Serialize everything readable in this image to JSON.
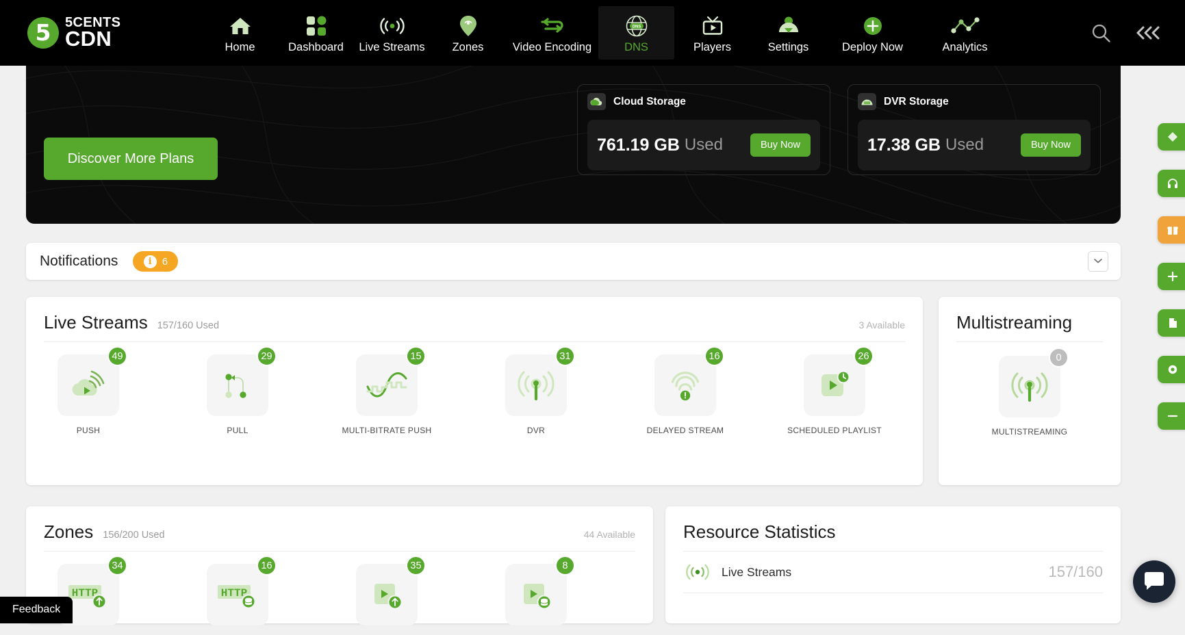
{
  "brand": {
    "mark": "5",
    "line1": "5CENTS",
    "line2": "CDN"
  },
  "nav": {
    "items": [
      {
        "label": "Home",
        "icon": "home-icon",
        "active": false
      },
      {
        "label": "Dashboard",
        "icon": "grid-icon",
        "active": false
      },
      {
        "label": "Live Streams",
        "icon": "broadcast-icon",
        "active": false
      },
      {
        "label": "Zones",
        "icon": "location-pin-icon",
        "active": false
      },
      {
        "label": "Video Encoding",
        "icon": "transcode-icon",
        "active": false
      },
      {
        "label": "DNS",
        "icon": "globe-dns-icon",
        "active": true
      },
      {
        "label": "Players",
        "icon": "tv-player-icon",
        "active": false
      },
      {
        "label": "Settings",
        "icon": "user-settings-icon",
        "active": false
      },
      {
        "label": "Deploy Now",
        "icon": "plus-circle-icon",
        "active": false
      },
      {
        "label": "Analytics",
        "icon": "line-chart-icon",
        "active": false
      }
    ],
    "search_icon": "search-icon",
    "collapse_icon": "double-chevron-left-icon"
  },
  "hero": {
    "discover_label": "Discover More Plans",
    "storage_cards": [
      {
        "title": "Cloud Storage",
        "icon": "cloud-storage-icon",
        "amount": "761.19 GB",
        "used_label": "Used",
        "button": "Buy Now"
      },
      {
        "title": "DVR Storage",
        "icon": "dvr-storage-icon",
        "amount": "17.38 GB",
        "used_label": "Used",
        "button": "Buy Now"
      }
    ]
  },
  "notifications": {
    "title": "Notifications",
    "count": "6",
    "info_glyph": "i",
    "collapse_icon": "chevron-collapse-icon"
  },
  "live_streams": {
    "title": "Live Streams",
    "subtitle": "157/160 Used",
    "available": "3 Available",
    "tiles": [
      {
        "label": "PUSH",
        "count": "49",
        "icon": "cloud-push-icon"
      },
      {
        "label": "PULL",
        "count": "29",
        "icon": "pull-nodes-icon"
      },
      {
        "label": "MULTI-BITRATE PUSH",
        "count": "15",
        "icon": "multibitrate-wave-icon"
      },
      {
        "label": "DVR",
        "count": "31",
        "icon": "dvr-antenna-icon"
      },
      {
        "label": "DELAYED STREAM",
        "count": "16",
        "icon": "delayed-signal-icon"
      },
      {
        "label": "SCHEDULED PLAYLIST",
        "count": "26",
        "icon": "scheduled-play-icon"
      }
    ]
  },
  "multistreaming": {
    "title": "Multistreaming",
    "tiles": [
      {
        "label": "MULTISTREAMING",
        "count": "0",
        "icon": "multistream-antenna-icon"
      }
    ]
  },
  "zones": {
    "title": "Zones",
    "subtitle": "156/200 Used",
    "available": "44 Available",
    "tiles": [
      {
        "label": "",
        "count": "34",
        "icon": "http-push-icon"
      },
      {
        "label": "",
        "count": "16",
        "icon": "http-pull-icon"
      },
      {
        "label": "",
        "count": "35",
        "icon": "vod-push-icon"
      },
      {
        "label": "",
        "count": "8",
        "icon": "vod-pull-icon"
      }
    ]
  },
  "resource_statistics": {
    "title": "Resource Statistics",
    "rows": [
      {
        "label": "Live Streams",
        "value": "157/160",
        "icon": "broadcast-small-icon"
      }
    ]
  },
  "feedback": {
    "label": "Feedback"
  },
  "colors": {
    "brand_green": "#56a92c",
    "badge_orange": "#f5a623",
    "nav_bg": "#000000",
    "hero_bg": "#0b0b0b"
  }
}
